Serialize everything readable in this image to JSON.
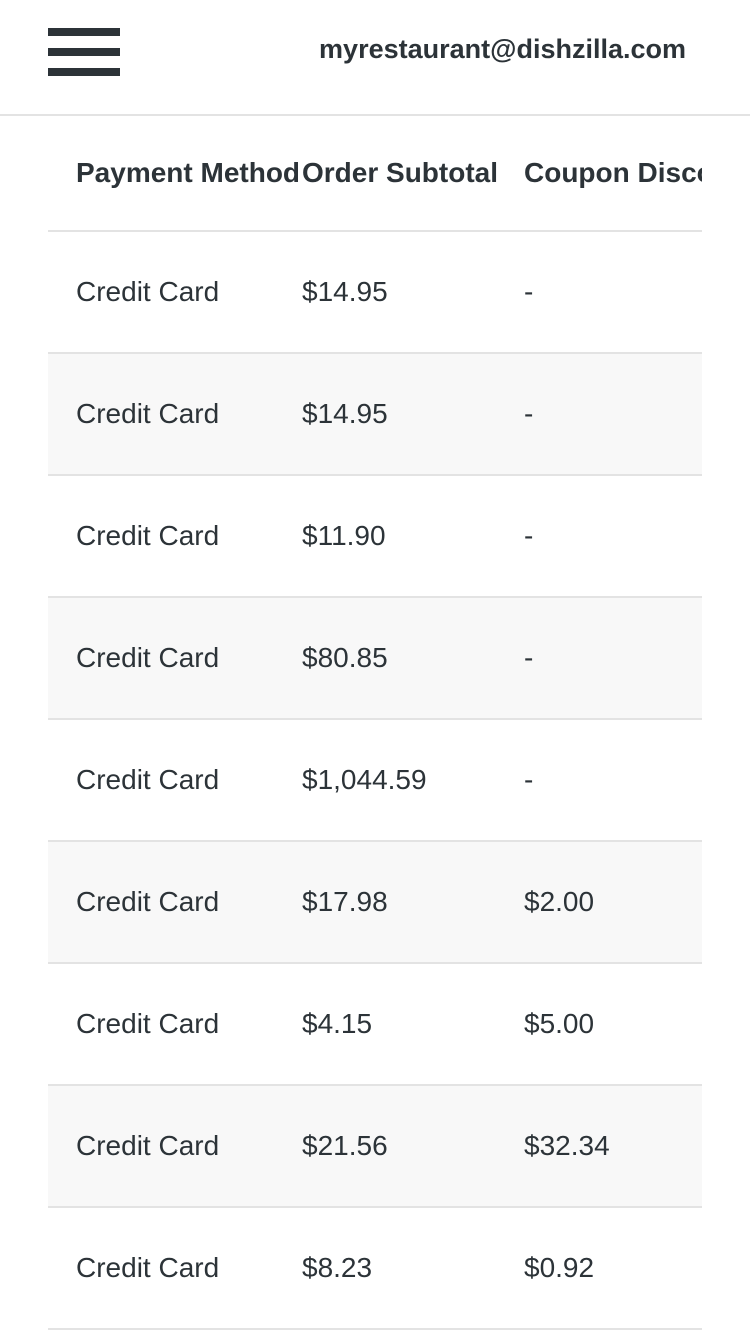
{
  "header": {
    "email": "myrestaurant@dishzilla.com"
  },
  "table": {
    "columns": [
      "Payment Method",
      "Order Subtotal",
      "Coupon Discount",
      ""
    ],
    "rows": [
      {
        "payment_method": "Credit Card",
        "order_subtotal": "$14.95",
        "coupon_discount": "-"
      },
      {
        "payment_method": "Credit Card",
        "order_subtotal": "$14.95",
        "coupon_discount": "-"
      },
      {
        "payment_method": "Credit Card",
        "order_subtotal": "$11.90",
        "coupon_discount": "-"
      },
      {
        "payment_method": "Credit Card",
        "order_subtotal": "$80.85",
        "coupon_discount": "-"
      },
      {
        "payment_method": "Credit Card",
        "order_subtotal": "$1,044.59",
        "coupon_discount": "-"
      },
      {
        "payment_method": "Credit Card",
        "order_subtotal": "$17.98",
        "coupon_discount": "$2.00"
      },
      {
        "payment_method": "Credit Card",
        "order_subtotal": "$4.15",
        "coupon_discount": "$5.00"
      },
      {
        "payment_method": "Credit Card",
        "order_subtotal": "$21.56",
        "coupon_discount": "$32.34"
      },
      {
        "payment_method": "Credit Card",
        "order_subtotal": "$8.23",
        "coupon_discount": "$0.92"
      }
    ]
  },
  "icons": {
    "menu": "hamburger-menu-icon"
  },
  "colors": {
    "text": "#2c3338",
    "row_alt": "#f8f8f8",
    "divider": "#e3e3e3"
  }
}
